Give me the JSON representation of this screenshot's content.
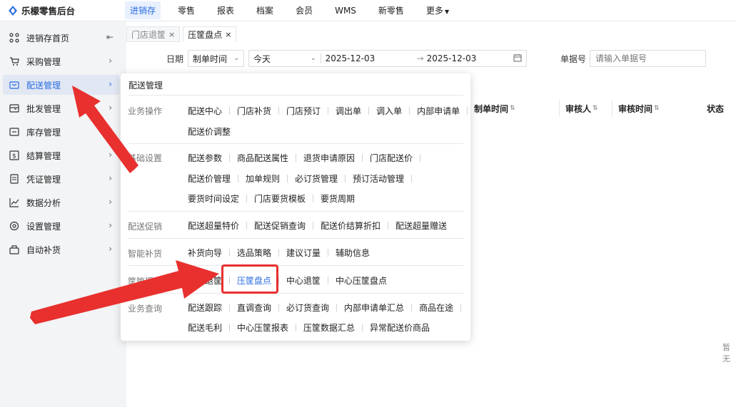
{
  "app": {
    "logo_text": "乐檬零售后台"
  },
  "topnav": [
    "进销存",
    "零售",
    "报表",
    "档案",
    "会员",
    "WMS",
    "新零售",
    "更多"
  ],
  "sidebar": [
    {
      "label": "进销存首页",
      "icon": "home-icon"
    },
    {
      "label": "采购管理",
      "icon": "cart-icon"
    },
    {
      "label": "配送管理",
      "icon": "delivery-icon"
    },
    {
      "label": "批发管理",
      "icon": "wholesale-icon"
    },
    {
      "label": "库存管理",
      "icon": "inventory-icon"
    },
    {
      "label": "结算管理",
      "icon": "money-icon"
    },
    {
      "label": "凭证管理",
      "icon": "document-icon"
    },
    {
      "label": "数据分析",
      "icon": "chart-icon"
    },
    {
      "label": "设置管理",
      "icon": "gear-icon"
    },
    {
      "label": "自动补货",
      "icon": "restock-icon"
    }
  ],
  "tabs": [
    {
      "label": "门店退筐"
    },
    {
      "label": "压筐盘点"
    }
  ],
  "filter": {
    "date_label": "日期",
    "date_type": "制单时间",
    "date_range": "今天",
    "start": "2025-12-03",
    "end": "2025-12-03",
    "order_label": "单据号",
    "order_placeholder": "请输入单据号"
  },
  "table": {
    "headers": [
      "制单时间",
      "审核人",
      "审核时间",
      "状态"
    ]
  },
  "empty_text": "暂无",
  "popup": {
    "title": "配送管理",
    "groups": [
      {
        "name": "业务操作",
        "rows": [
          [
            "配送中心",
            "门店补货",
            "门店预订",
            "调出单",
            "调入单",
            "内部申请单"
          ],
          [
            "配送价调整"
          ]
        ]
      },
      {
        "name": "基础设置",
        "rows": [
          [
            "配送参数",
            "商品配送属性",
            "退货申请原因",
            "门店配送价"
          ],
          [
            "配送价管理",
            "加单规则",
            "必订货管理",
            "预订活动管理"
          ],
          [
            "要货时间设定",
            "门店要货模板",
            "要货周期"
          ]
        ]
      },
      {
        "name": "配送促销",
        "rows": [
          [
            "配送超量特价",
            "配送促销查询",
            "配送价结算折扣",
            "配送超量赠送"
          ]
        ]
      },
      {
        "name": "智能补货",
        "rows": [
          [
            "补货向导",
            "选品策略",
            "建议订量",
            "辅助信息"
          ]
        ]
      },
      {
        "name": "筐管理",
        "rows": [
          [
            "门店退筐",
            "压筐盘点",
            "中心退筐",
            "中心压筐盘点"
          ]
        ]
      },
      {
        "name": "业务查询",
        "rows": [
          [
            "配送跟踪",
            "直调查询",
            "必订货查询",
            "内部申请单汇总",
            "商品在途"
          ],
          [
            "配送毛利",
            "中心压筐报表",
            "压筐数据汇总",
            "异常配送价商品"
          ]
        ]
      }
    ]
  },
  "colors": {
    "accent": "#2b6de0",
    "highlight": "#e8302e"
  }
}
